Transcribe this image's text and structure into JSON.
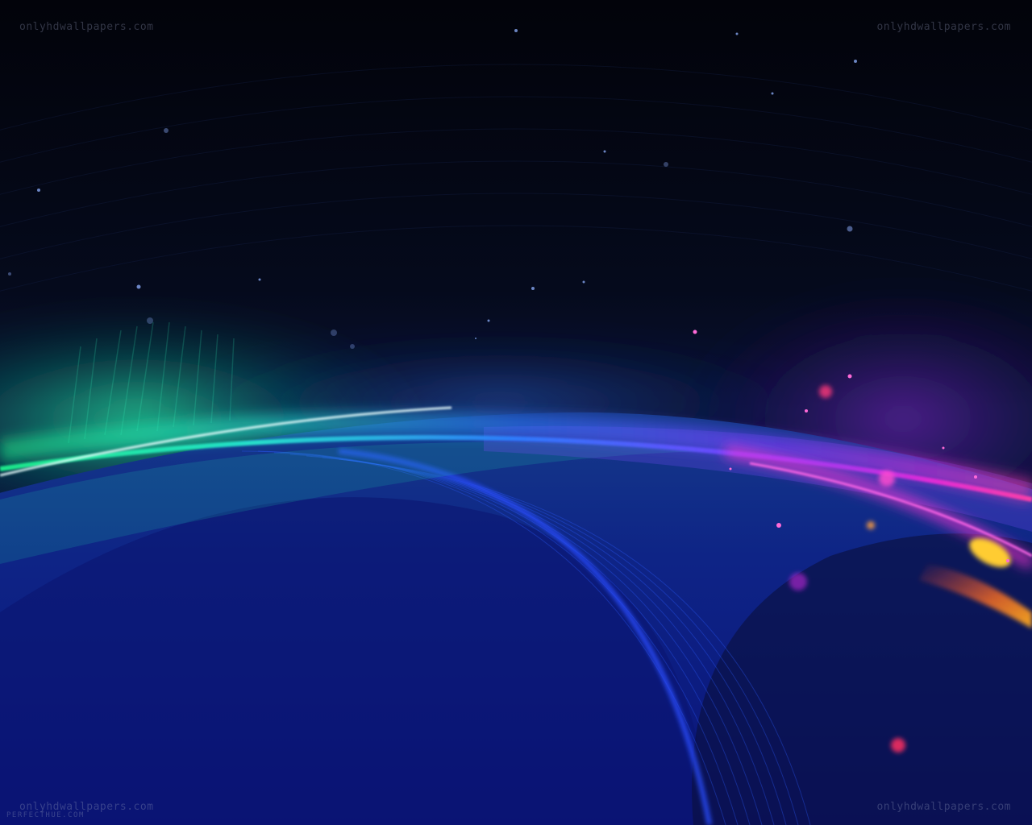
{
  "watermarks": {
    "top_left": "onlyhdwallpapers.com",
    "top_right": "onlyhdwallpapers.com",
    "bottom_left": "onlyhdwallpapers.com",
    "bottom_right": "onlyhdwallpapers.com",
    "credit": "PERFECTHUE.COM"
  },
  "palette": {
    "sky": "#03040d",
    "deep_blue": "#0d1a7a",
    "green_glow": "#1de38a",
    "cyan_glow": "#2ee6d6",
    "blue_glow": "#2a6cff",
    "magenta_glow": "#e22ad8",
    "orange_glow": "#ffb020",
    "red_spark": "#ff3060"
  }
}
